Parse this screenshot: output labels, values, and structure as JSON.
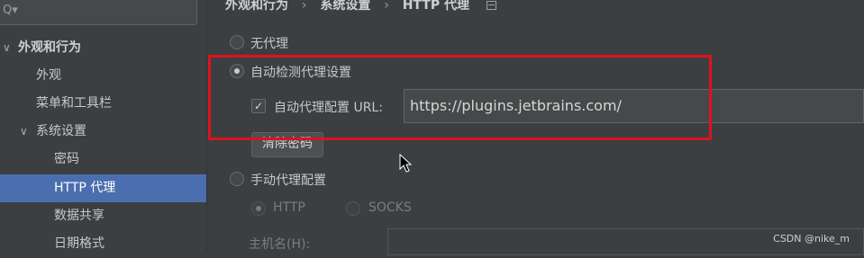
{
  "sidebar": {
    "search_icon_glyph": "Q▾",
    "items": [
      {
        "label": "外观和行为",
        "expand": "∨"
      },
      {
        "label": "外观"
      },
      {
        "label": "菜单和工具栏"
      },
      {
        "label": "系统设置",
        "expand": "∨"
      },
      {
        "label": "密码"
      },
      {
        "label": "HTTP 代理"
      },
      {
        "label": "数据共享"
      },
      {
        "label": "日期格式"
      }
    ]
  },
  "breadcrumb": {
    "items": [
      "外观和行为",
      "系统设置",
      "HTTP 代理"
    ],
    "separator": "›"
  },
  "proxy": {
    "no_proxy_label": "无代理",
    "auto_detect_label": "自动检测代理设置",
    "auto_config_label": "自动代理配置 URL:",
    "auto_config_checked": "✓",
    "auto_config_url": "https://plugins.jetbrains.com/",
    "clear_password_label": "清除密码",
    "manual_label": "手动代理配置",
    "http_label": "HTTP",
    "socks_label": "SOCKS",
    "host_label": "主机名(H):"
  },
  "watermark": "CSDN @nike_m",
  "colors": {
    "accent_selection": "#4b6eaf",
    "annotation": "#e0121b"
  }
}
